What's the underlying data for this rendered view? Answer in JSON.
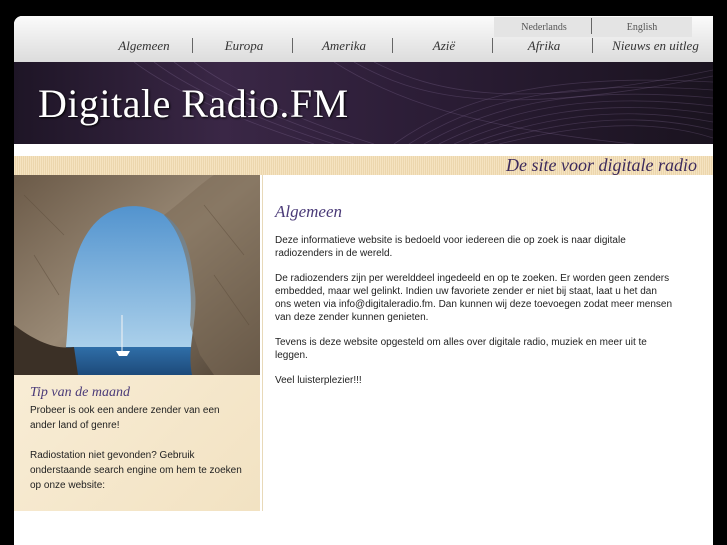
{
  "language_links": [
    {
      "label": "Nederlands"
    },
    {
      "label": "English"
    }
  ],
  "nav": [
    {
      "label": "Algemeen"
    },
    {
      "label": "Europa"
    },
    {
      "label": "Amerika"
    },
    {
      "label": "Azië"
    },
    {
      "label": "Afrika"
    },
    {
      "label": "Nieuws en uitleg"
    }
  ],
  "banner": {
    "title": "Digitale Radio.FM"
  },
  "tagline": "De site voor digitale radio",
  "sidebar": {
    "tip_title": "Tip van de maand",
    "tip_paragraphs": [
      "Probeer is ook een andere zender van een ander land of genre!",
      "Radiostation niet gevonden? Gebruik onderstaande search engine om hem te zoeken op onze website:"
    ]
  },
  "main": {
    "heading": "Algemeen",
    "paragraphs": [
      "Deze informatieve website is bedoeld voor iedereen die op zoek is naar digitale radiozenders in de wereld.",
      "De radiozenders zijn per werelddeel ingedeeld en op te zoeken. Er worden geen zenders embedded, maar wel gelinkt. Indien uw favoriete zender er niet bij staat, laat u het dan ons weten via info@digitaleradio.fm. Dan kunnen wij deze toevoegen zodat meer mensen van deze zender kunnen genieten.",
      "Tevens is deze website opgesteld om alles over digitale radio, muziek en meer uit te leggen.",
      "Veel luisterplezier!!!"
    ]
  }
}
